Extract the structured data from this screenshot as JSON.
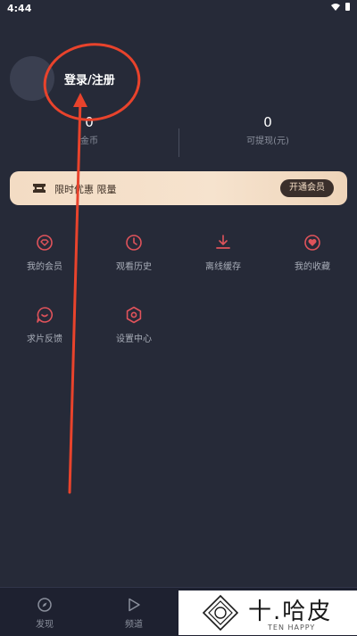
{
  "status_bar": {
    "time": "4:44",
    "icons": [
      "wifi-icon",
      "battery-icon"
    ]
  },
  "profile": {
    "login_label": "登录/注册"
  },
  "stats": [
    {
      "value": "0",
      "label": "金币"
    },
    {
      "value": "0",
      "label": "可提现(元)"
    }
  ],
  "vip_banner": {
    "icon": "ticket-icon",
    "text": "限时优惠 限量",
    "button_label": "开通会员"
  },
  "menu": [
    {
      "label": "我的会员",
      "icon": "vip-diamond-icon"
    },
    {
      "label": "观看历史",
      "icon": "clock-icon"
    },
    {
      "label": "离线缓存",
      "icon": "download-icon"
    },
    {
      "label": "我的收藏",
      "icon": "heart-icon"
    },
    {
      "label": "求片反馈",
      "icon": "feedback-icon"
    },
    {
      "label": "设置中心",
      "icon": "settings-icon"
    }
  ],
  "bottom_nav": [
    {
      "label": "发现",
      "icon": "compass-icon"
    },
    {
      "label": "频道",
      "icon": "play-icon"
    }
  ],
  "watermark": {
    "title": "十.哈皮",
    "subtitle": "TEN HAPPY"
  },
  "colors": {
    "background": "#262a38",
    "accent": "#e0535b",
    "annotation": "#e8432c",
    "vip_gold": "#f3dcc4"
  }
}
